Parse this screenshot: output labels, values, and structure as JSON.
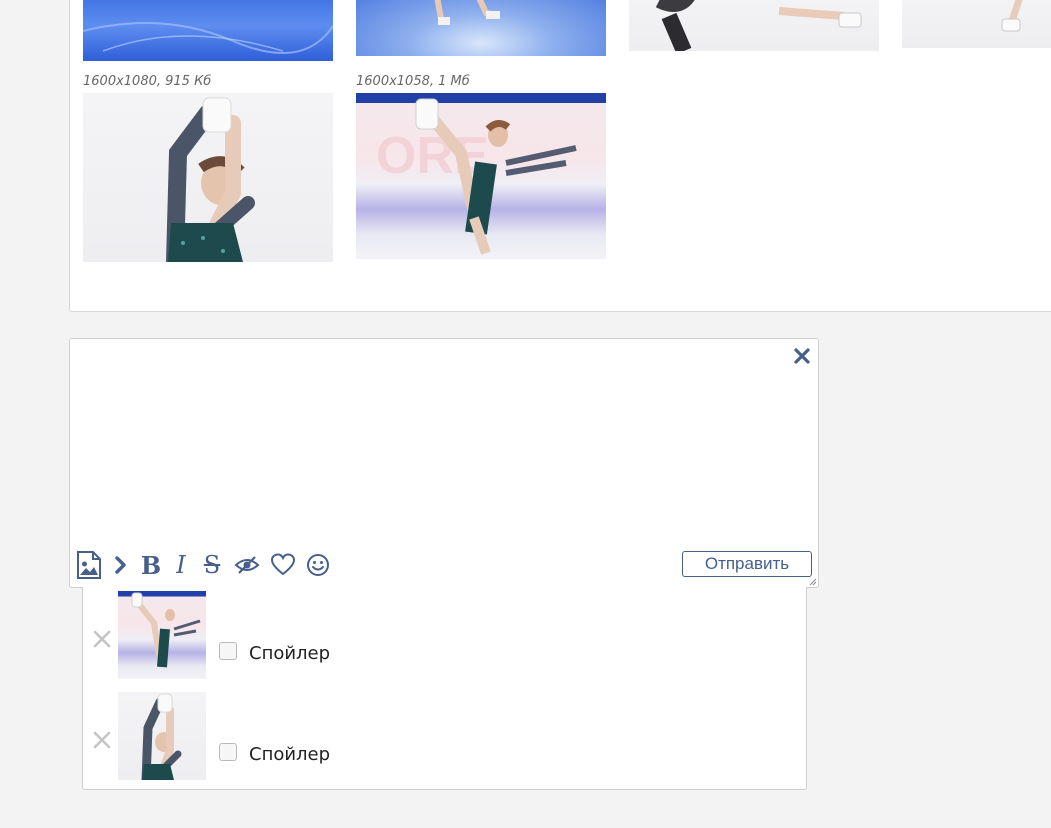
{
  "gallery": {
    "photos": [
      {
        "meta": ""
      },
      {
        "meta": ""
      },
      {
        "meta": ""
      },
      {
        "meta": ""
      },
      {
        "meta": "1600x1080, 915 Кб"
      },
      {
        "meta": "1600x1058, 1 Мб"
      }
    ]
  },
  "editor": {
    "text": "",
    "toolbar": {
      "icons": [
        "image-upload-icon",
        "quote-chevron-icon",
        "bold-icon",
        "italic-icon",
        "strikethrough-icon",
        "spoiler-eye-icon",
        "heart-icon",
        "emoji-icon"
      ],
      "bold_glyph": "B",
      "italic_glyph": "I",
      "strike_glyph": "S"
    },
    "send_label": "Отправить"
  },
  "attachments": {
    "items": [
      {
        "spoiler_label": "Спойлер",
        "checked": false
      },
      {
        "spoiler_label": "Спойлер",
        "checked": false
      }
    ]
  },
  "colors": {
    "accent": "#46608a",
    "background": "#f3f3f3",
    "border": "#cfcfcf"
  }
}
